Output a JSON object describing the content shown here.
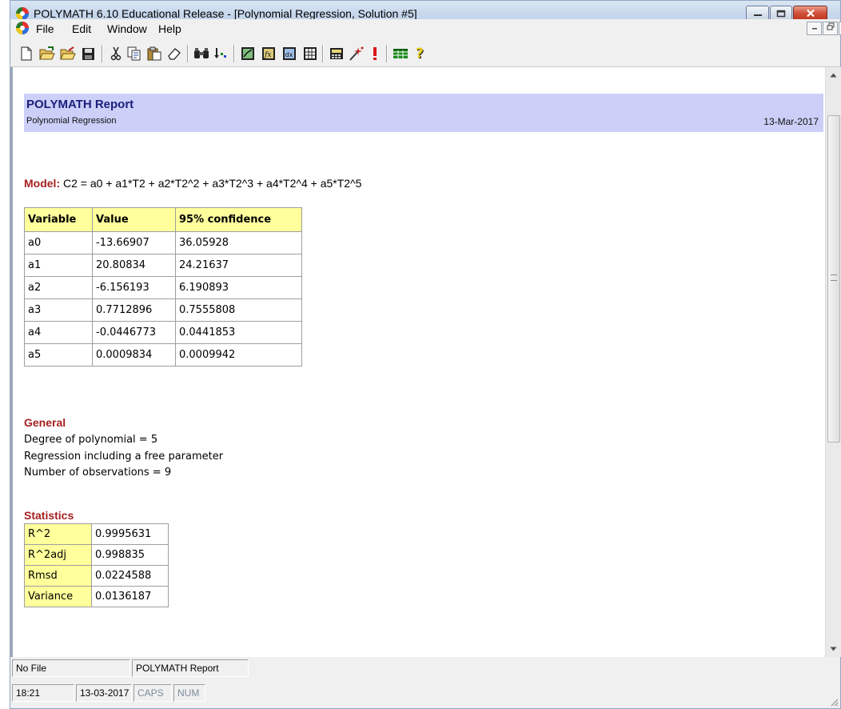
{
  "window": {
    "title": "POLYMATH 6.10 Educational Release - [Polynomial Regression, Solution #5]"
  },
  "menu": {
    "items": [
      "File",
      "Edit",
      "Window",
      "Help"
    ]
  },
  "toolbar": {
    "icons": [
      "new-icon",
      "open-icon",
      "open-alt-icon",
      "save-icon",
      "cut-icon",
      "copy-icon",
      "paste-icon",
      "eraser-icon",
      "find-icon",
      "sort-icon",
      "graph-icon",
      "function-icon",
      "derivative-icon",
      "table-icon",
      "calculator-icon",
      "wizard-icon",
      "run-icon",
      "spreadsheet-icon",
      "help-icon"
    ]
  },
  "report": {
    "title": "POLYMATH Report",
    "subtitle": "Polynomial Regression",
    "date": "13-Mar-2017",
    "model_label": "Model:",
    "model_equation": "C2 = a0 + a1*T2 + a2*T2^2 + a3*T2^3 + a4*T2^4 + a5*T2^5",
    "param_headers": [
      "Variable",
      "Value",
      "95% confidence"
    ],
    "params": [
      [
        "a0",
        "-13.66907",
        "36.05928"
      ],
      [
        "a1",
        "20.80834",
        "24.21637"
      ],
      [
        "a2",
        "-6.156193",
        "6.190893"
      ],
      [
        "a3",
        "0.7712896",
        "0.7555808"
      ],
      [
        "a4",
        "-0.0446773",
        "0.0441853"
      ],
      [
        "a5",
        "0.0009834",
        "0.0009942"
      ]
    ],
    "general_title": "General",
    "general_lines": [
      "Degree of polynomial = 5",
      "Regression including a free parameter",
      "Number of observations = 9"
    ],
    "stats_title": "Statistics",
    "stats": [
      [
        "R^2",
        "0.9995631"
      ],
      [
        "R^2adj",
        "0.998835"
      ],
      [
        "Rmsd",
        "0.0224588"
      ],
      [
        "Variance",
        "0.0136187"
      ]
    ]
  },
  "status": {
    "file": "No File",
    "doc": "POLYMATH Report",
    "time": "18:21",
    "date": "13-03-2017",
    "caps": "CAPS",
    "num": "NUM"
  },
  "colors": {
    "header_bg": "#cccff8",
    "header_title": "#1a1e7a",
    "section_title": "#a62121",
    "table_header_bg": "#ffff9c"
  }
}
